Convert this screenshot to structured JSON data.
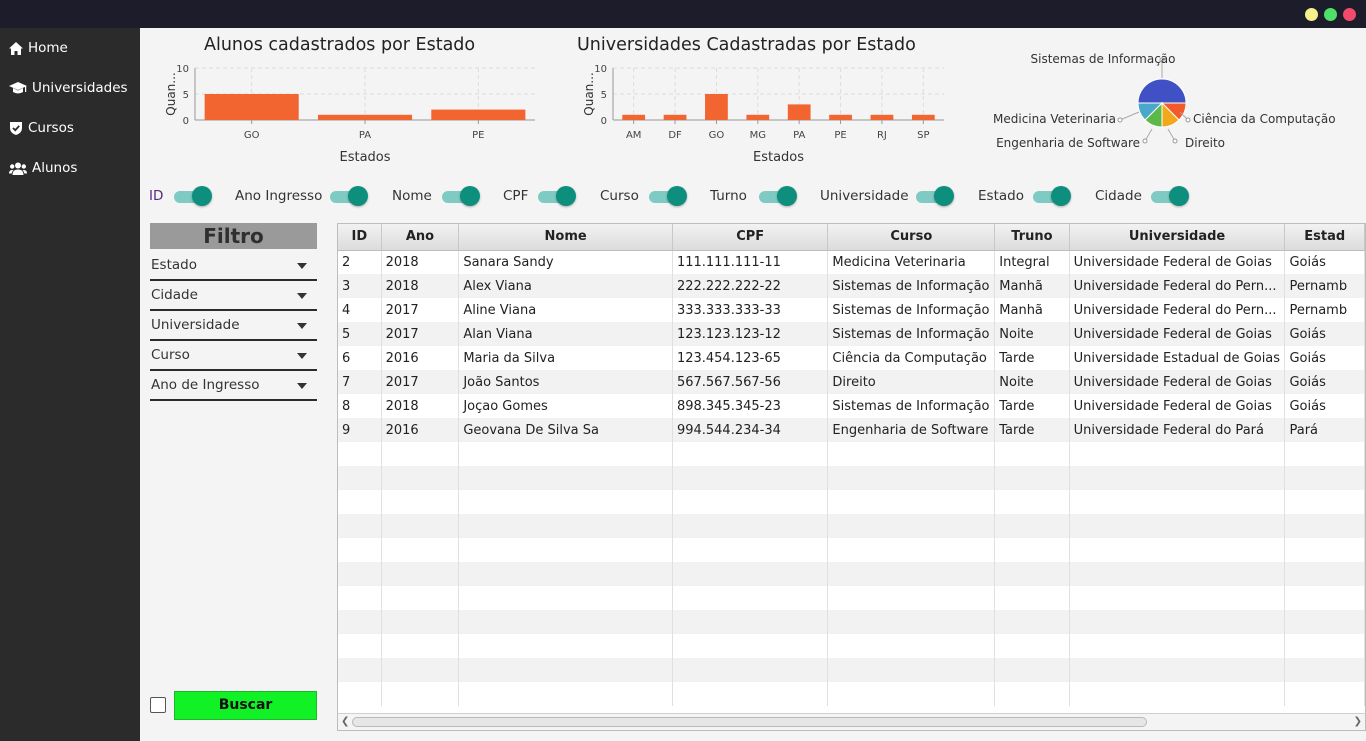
{
  "window": {
    "controls": [
      "minimize",
      "maximize",
      "close"
    ]
  },
  "sidebar": {
    "items": [
      {
        "label": "Home",
        "icon": "home-icon"
      },
      {
        "label": "Universidades",
        "icon": "graduation-cap-icon"
      },
      {
        "label": "Cursos",
        "icon": "shield-check-icon"
      },
      {
        "label": "Alunos",
        "icon": "users-icon"
      }
    ]
  },
  "charts": {
    "students": {
      "title": "Alunos cadastrados por Estado"
    },
    "universities": {
      "title": "Universidades Cadastradas por Estado"
    },
    "courses": {
      "title": ""
    }
  },
  "chart_data": [
    {
      "type": "bar",
      "title": "Alunos cadastrados por Estado",
      "xlabel": "Estados",
      "ylabel": "Quan...",
      "categories": [
        "GO",
        "PA",
        "PE"
      ],
      "values": [
        5,
        1,
        2
      ],
      "ylim": [
        0,
        10
      ],
      "yticks": [
        0,
        5,
        10
      ],
      "color": "#f26430",
      "grid": true
    },
    {
      "type": "bar",
      "title": "Universidades Cadastradas por Estado",
      "xlabel": "Estados",
      "ylabel": "Quan...",
      "categories": [
        "AM",
        "DF",
        "GO",
        "MG",
        "PA",
        "PE",
        "RJ",
        "SP"
      ],
      "values": [
        1,
        1,
        5,
        1,
        3,
        1,
        1,
        1
      ],
      "ylim": [
        0,
        10
      ],
      "yticks": [
        0,
        5,
        10
      ],
      "color": "#f26430",
      "grid": true
    },
    {
      "type": "pie",
      "title": "",
      "labels": [
        "Sistemas de Informação",
        "Ciência da Computação",
        "Direito",
        "Engenharia de Software",
        "Medicina Veterinaria"
      ],
      "values": [
        4,
        1,
        1,
        1,
        1
      ],
      "colors": [
        "#3f51c4",
        "#f25a2a",
        "#f2a81d",
        "#5cb848",
        "#4aa8c8"
      ],
      "legend": "labels-with-leader-lines"
    }
  ],
  "toggles": [
    {
      "label": "ID",
      "on": true
    },
    {
      "label": "Ano Ingresso",
      "on": true
    },
    {
      "label": "Nome",
      "on": true
    },
    {
      "label": "CPF",
      "on": true
    },
    {
      "label": "Curso",
      "on": true
    },
    {
      "label": "Turno",
      "on": true
    },
    {
      "label": "Universidade",
      "on": true
    },
    {
      "label": "Estado",
      "on": true
    },
    {
      "label": "Cidade",
      "on": true
    }
  ],
  "filter": {
    "title": "Filtro",
    "selects": [
      "Estado",
      "Cidade",
      "Universidade",
      "Curso",
      "Ano de Ingresso"
    ],
    "search_label": "Buscar",
    "checkbox_checked": false
  },
  "table": {
    "columns": [
      "ID",
      "Ano",
      "Nome",
      "CPF",
      "Curso",
      "Truno",
      "Universidade",
      "Estad"
    ],
    "rows": [
      [
        "2",
        "2018",
        "Sanara Sandy",
        "111.111.111-11",
        "Medicina Veterinaria",
        "Integral",
        "Universidade Federal de Goias",
        "Goiás"
      ],
      [
        "3",
        "2018",
        "Alex Viana",
        "222.222.222-22",
        "Sistemas de Informação",
        "Manhã",
        "Universidade Federal do Pern...",
        "Pernamb"
      ],
      [
        "4",
        "2017",
        "Aline Viana",
        "333.333.333-33",
        "Sistemas de Informação",
        "Manhã",
        "Universidade Federal do Pern...",
        "Pernamb"
      ],
      [
        "5",
        "2017",
        "Alan Viana",
        "123.123.123-12",
        "Sistemas de Informação",
        "Noite",
        "Universidade Federal de Goias",
        "Goiás"
      ],
      [
        "6",
        "2016",
        "Maria da Silva",
        "123.454.123-65",
        "Ciência da Computação",
        "Tarde",
        "Universidade Estadual de Goias",
        "Goiás"
      ],
      [
        "7",
        "2017",
        "João Santos",
        "567.567.567-56",
        "Direito",
        "Noite",
        "Universidade Federal de Goias",
        "Goiás"
      ],
      [
        "8",
        "2018",
        "Joçao Gomes",
        "898.345.345-23",
        "Sistemas de Informação",
        "Tarde",
        "Universidade Federal de Goias",
        "Goiás"
      ],
      [
        "9",
        "2016",
        "Geovana De Silva Sa",
        "994.544.234-34",
        "Engenharia de Software",
        "Tarde",
        "Universidade Federal do Pará",
        "Pará"
      ]
    ]
  }
}
